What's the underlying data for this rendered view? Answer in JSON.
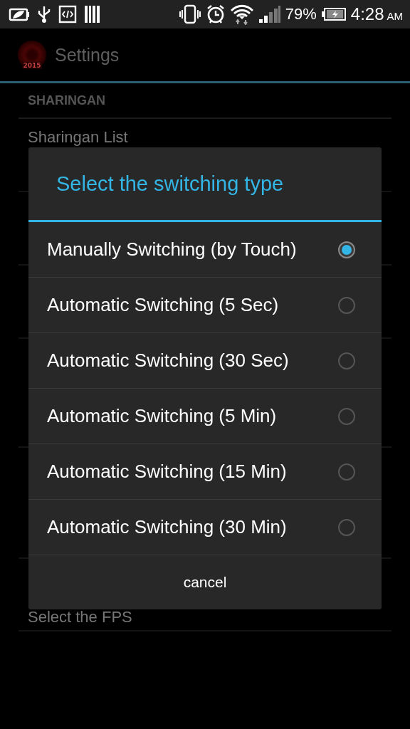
{
  "status_bar": {
    "battery_percent": "79%",
    "time": "4:28",
    "meridiem": "AM"
  },
  "action_bar": {
    "app_icon_text": "2015",
    "title": "Settings"
  },
  "settings": {
    "section": "SHARINGAN",
    "first_item": "Sharingan List",
    "last_item": "Select the FPS"
  },
  "dialog": {
    "title": "Select the switching type",
    "options": [
      {
        "label": "Manually Switching (by Touch)",
        "selected": true
      },
      {
        "label": "Automatic Switching (5 Sec)",
        "selected": false
      },
      {
        "label": "Automatic Switching (30 Sec)",
        "selected": false
      },
      {
        "label": "Automatic Switching (5 Min)",
        "selected": false
      },
      {
        "label": "Automatic Switching (15 Min)",
        "selected": false
      },
      {
        "label": "Automatic Switching (30 Min)",
        "selected": false
      }
    ],
    "cancel": "cancel"
  }
}
